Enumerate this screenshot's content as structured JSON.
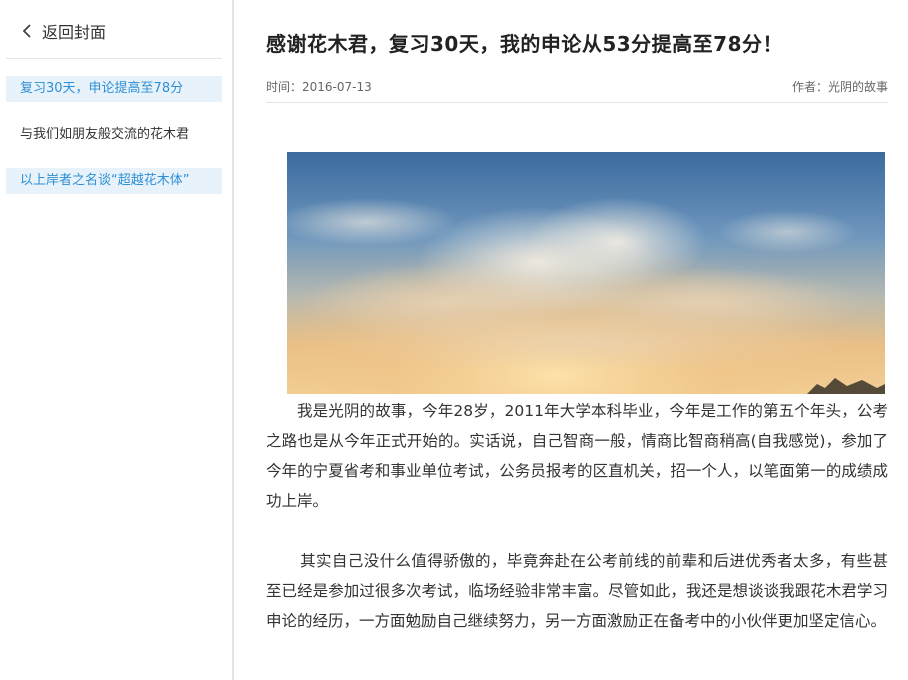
{
  "sidebar": {
    "back_label": "返回封面",
    "items": [
      {
        "label": "复习30天，申论提高至78分",
        "active": true
      },
      {
        "label": "与我们如朋友般交流的花木君",
        "active": false
      },
      {
        "label": "以上岸者之名谈“超越花木体”",
        "active": true
      }
    ]
  },
  "article": {
    "title": "感谢花木君，复习30天，我的申论从53分提高至78分！",
    "time_label": "时间：2016-07-13",
    "author_label": "作者：光阴的故事",
    "paragraphs": [
      "我是光阴的故事，今年28岁，2011年大学本科毕业，今年是工作的第五个年头，公考之路也是从今年正式开始的。实话说，自己智商一般，情商比智商稍高(自我感觉)，参加了今年的宁夏省考和事业单位考试，公务员报考的区直机关，招一个人，以笔面第一的成绩成功上岸。",
      "其实自己没什么值得骄傲的，毕竟奔赴在公考前线的前辈和后进优秀者太多，有些甚至已经是参加过很多次考试，临场经验非常丰富。尽管如此，我还是想谈谈我跟花木君学习申论的经历，一方面勉励自己继续努力，另一方面激励正在备考中的小伙伴更加坚定信心。"
    ]
  },
  "colors": {
    "active_bg": "#e8f2fb",
    "active_text": "#2d8fd5",
    "sky_top": "#3f6fa3",
    "sky_glow": "#f2c486"
  },
  "icons": {
    "back": "chevron-left-icon"
  }
}
